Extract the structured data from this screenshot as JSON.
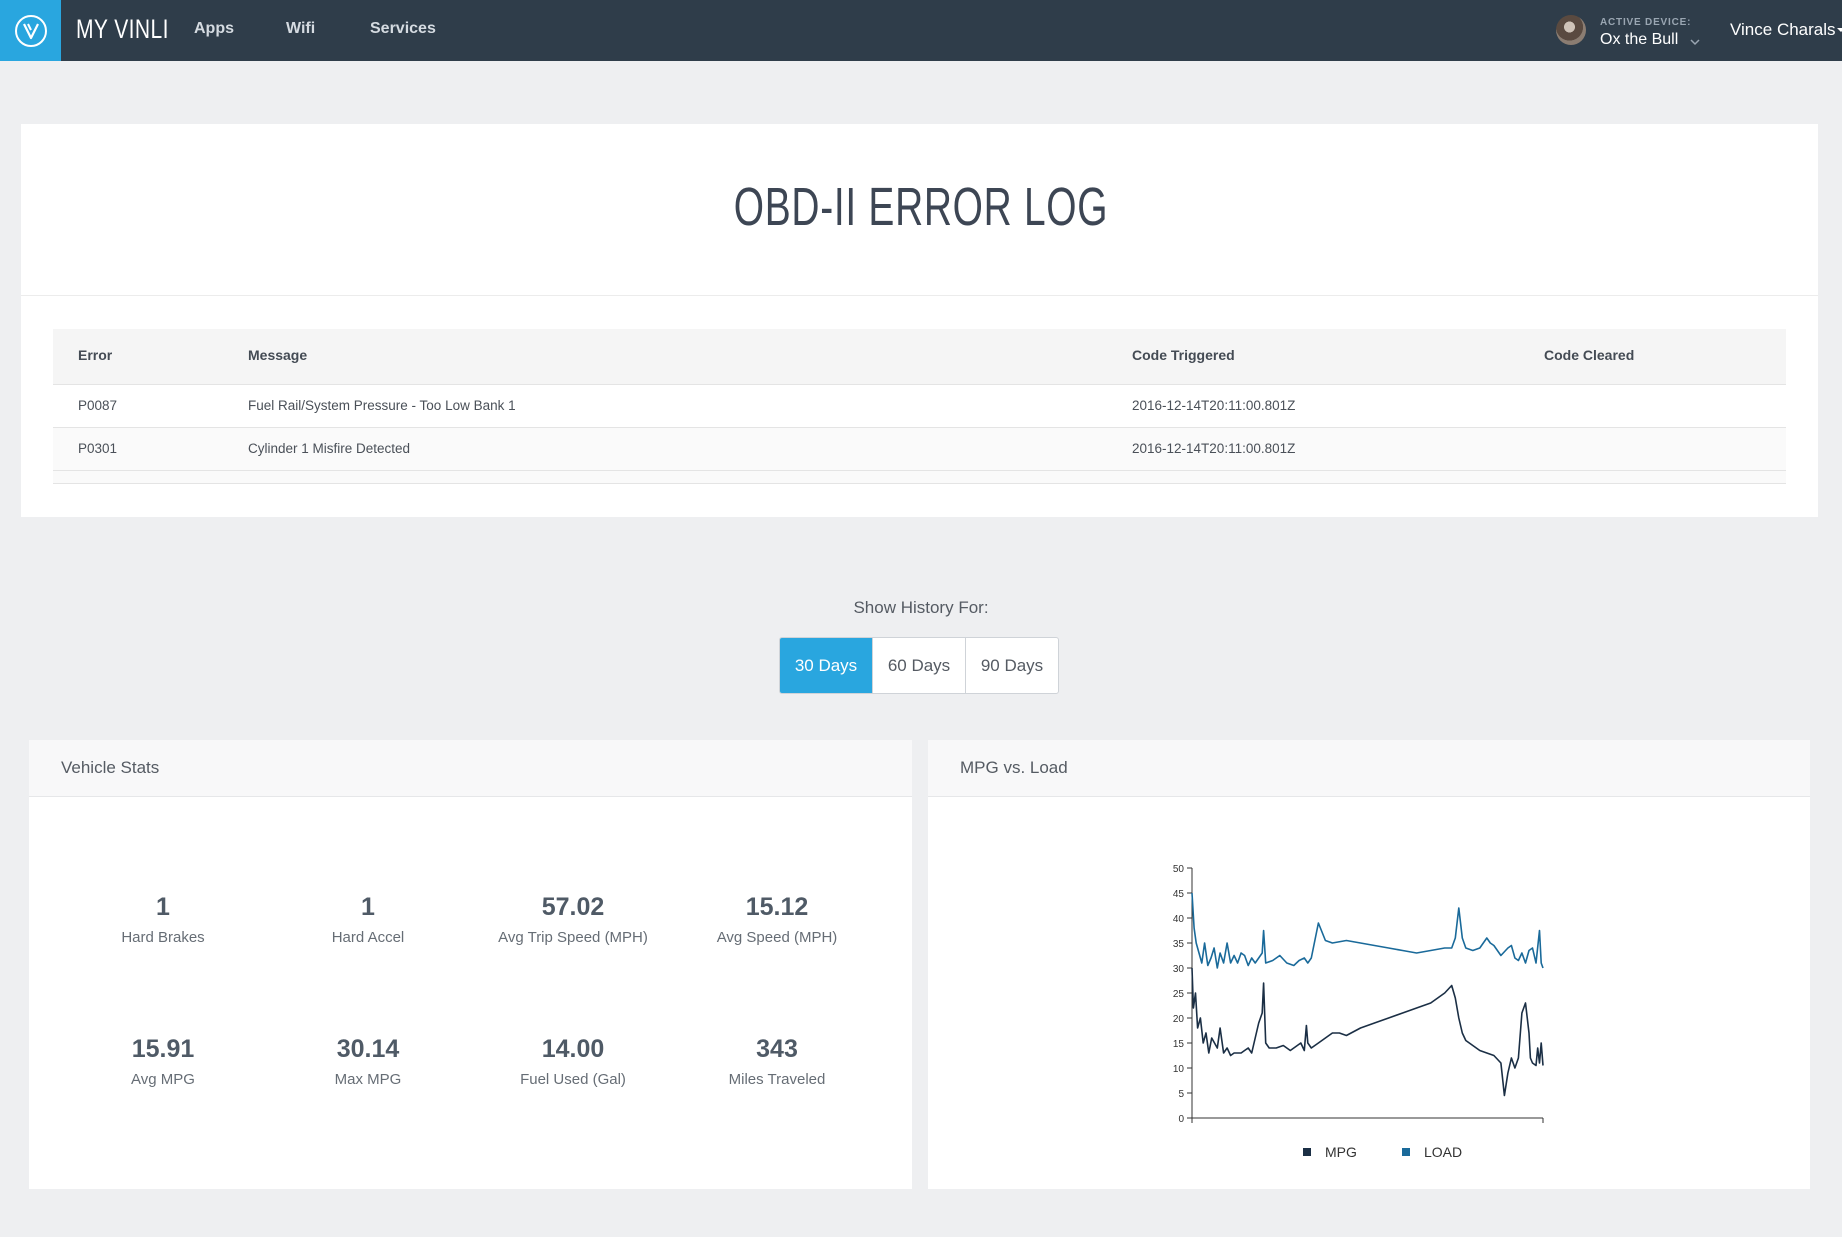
{
  "nav": {
    "brand": "MY VINLI",
    "links": [
      "Apps",
      "Wifi",
      "Services"
    ],
    "active_device_label": "ACTIVE DEVICE:",
    "active_device_name": "Ox the Bull",
    "user_name": "Vince Charals"
  },
  "error_log": {
    "title": "OBD-II ERROR LOG",
    "headers": [
      "Error",
      "Message",
      "Code Triggered",
      "Code Cleared"
    ],
    "rows": [
      {
        "error": "P0087",
        "message": "Fuel Rail/System Pressure - Too Low Bank 1",
        "triggered": "2016-12-14T20:11:00.801Z",
        "cleared": ""
      },
      {
        "error": "P0301",
        "message": "Cylinder 1 Misfire Detected",
        "triggered": "2016-12-14T20:11:00.801Z",
        "cleared": ""
      }
    ]
  },
  "history": {
    "label": "Show History For:",
    "options": [
      "30 Days",
      "60 Days",
      "90 Days"
    ],
    "selected": "30 Days",
    "accent_color": "#29a6df"
  },
  "vehicle_stats": {
    "title": "Vehicle Stats",
    "stats": [
      {
        "value": "1",
        "label": "Hard Brakes"
      },
      {
        "value": "1",
        "label": "Hard Accel"
      },
      {
        "value": "57.02",
        "label": "Avg Trip Speed (MPH)"
      },
      {
        "value": "15.12",
        "label": "Avg Speed (MPH)"
      },
      {
        "value": "15.91",
        "label": "Avg MPG"
      },
      {
        "value": "30.14",
        "label": "Max MPG"
      },
      {
        "value": "14.00",
        "label": "Fuel Used (Gal)"
      },
      {
        "value": "343",
        "label": "Miles Traveled"
      }
    ]
  },
  "mpg_chart": {
    "title": "MPG vs. Load"
  },
  "chart_data": {
    "type": "line",
    "title": "MPG vs. Load",
    "xlabel": "",
    "ylabel": "",
    "ylim": [
      0,
      50
    ],
    "yticks": [
      0,
      5,
      10,
      15,
      20,
      25,
      30,
      35,
      40,
      45,
      50
    ],
    "xlim": [
      0,
      100
    ],
    "legend_position": "bottom",
    "grid": false,
    "series": [
      {
        "name": "MPG",
        "color": "#1b2f45",
        "x": [
          0,
          0.4,
          1,
          1.6,
          2.4,
          3.2,
          4,
          4.8,
          5.6,
          6.4,
          7.2,
          8,
          9,
          10,
          11,
          12,
          13,
          14,
          15,
          16,
          17,
          18,
          19,
          20,
          20.4,
          21,
          22,
          24,
          26,
          28,
          30,
          31,
          32,
          32.6,
          33,
          34,
          36,
          38,
          40,
          42,
          44,
          48,
          52,
          56,
          60,
          64,
          68,
          70,
          72,
          74,
          75,
          76,
          77,
          78,
          79,
          80,
          82,
          84,
          86,
          88,
          89,
          90,
          91,
          92,
          93,
          94,
          95,
          96,
          96.4,
          97,
          98,
          98.5,
          99,
          99.5,
          100
        ],
        "y": [
          30,
          22,
          25,
          18,
          20,
          15,
          17,
          13,
          16,
          15,
          14,
          18,
          13,
          14,
          12.5,
          13,
          13,
          13,
          13.5,
          14,
          13,
          16,
          19,
          21,
          27,
          15,
          14,
          14,
          14.5,
          13.5,
          14.5,
          15,
          13.5,
          18.5,
          15,
          14,
          15,
          16,
          17,
          17,
          16.5,
          18,
          19,
          20,
          21,
          22,
          23,
          24,
          25,
          26.5,
          24,
          20,
          17,
          15.5,
          15,
          14.5,
          13.5,
          13,
          12.5,
          11,
          4.5,
          9,
          12,
          10,
          12,
          21,
          23,
          17,
          12,
          11,
          10.5,
          14,
          11,
          15,
          10.5
        ]
      },
      {
        "name": "LOAD",
        "color": "#1a6a9a",
        "x": [
          0,
          0.6,
          1.2,
          2,
          2.8,
          3.6,
          4.5,
          5.4,
          6.3,
          7.2,
          8,
          9,
          10,
          11,
          12,
          13,
          14,
          15,
          16,
          17,
          18,
          19,
          20,
          20.4,
          21,
          23,
          25,
          27,
          29,
          30.5,
          32,
          33,
          34,
          36,
          38,
          40,
          44,
          48,
          52,
          56,
          60,
          64,
          68,
          72,
          74,
          75,
          76,
          77,
          78,
          80,
          82,
          84,
          85,
          86,
          88,
          90,
          91,
          92,
          93,
          94,
          95,
          96,
          97,
          98,
          99,
          99.5,
          100
        ],
        "y": [
          45,
          38,
          35,
          33,
          31,
          35,
          30.5,
          32,
          34,
          30,
          33,
          31,
          35,
          31,
          32.5,
          31,
          33,
          32.5,
          30.5,
          32,
          31,
          32,
          33,
          37.5,
          31,
          31.5,
          32.5,
          31,
          30.5,
          31.5,
          32,
          31,
          32,
          39,
          35.5,
          35,
          35.5,
          35,
          34.5,
          34,
          33.5,
          33,
          33.5,
          34,
          34,
          36,
          42,
          36,
          34,
          33.5,
          34,
          36,
          35,
          34.5,
          32.5,
          34,
          34.5,
          32,
          31.5,
          33,
          31,
          33.5,
          34,
          31,
          37.5,
          31,
          30
        ]
      }
    ]
  }
}
